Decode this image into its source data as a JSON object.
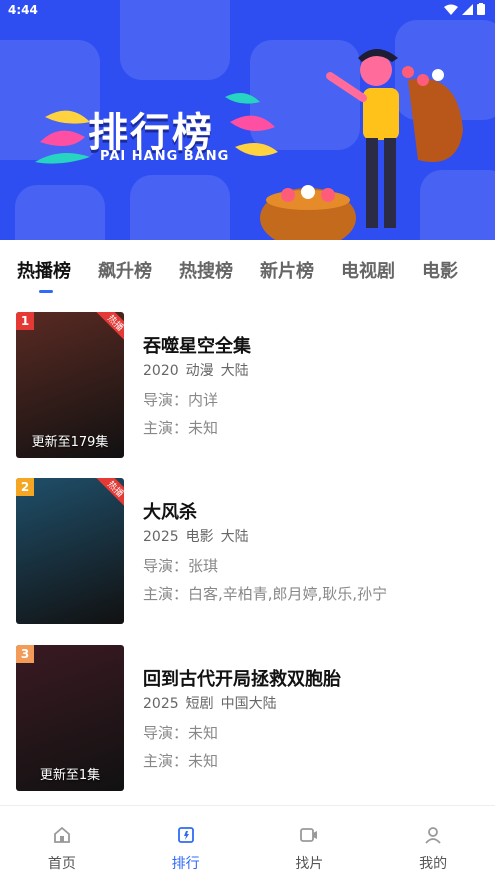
{
  "status": {
    "time": "4:44"
  },
  "banner": {
    "title": "排行榜",
    "subtitle": "PAI HANG BANG"
  },
  "tabs": [
    {
      "label": "热播榜",
      "active": true
    },
    {
      "label": "飙升榜",
      "active": false
    },
    {
      "label": "热搜榜",
      "active": false
    },
    {
      "label": "新片榜",
      "active": false
    },
    {
      "label": "电视剧",
      "active": false
    },
    {
      "label": "电影",
      "active": false
    }
  ],
  "items": [
    {
      "rank": "1",
      "title": "吞噬星空全集",
      "year": "2020",
      "type": "动漫",
      "region": "大陆",
      "director": "导演：内详",
      "cast": "主演：未知",
      "poster_caption": "更新至179集",
      "badge": "热播",
      "colors": {
        "rank": "#e53935",
        "poster": "#5a2a23"
      }
    },
    {
      "rank": "2",
      "title": "大风杀",
      "year": "2025",
      "type": "电影",
      "region": "大陆",
      "director": "导演：张琪",
      "cast": "主演：白客,辛柏青,郎月婷,耿乐,孙宁",
      "poster_caption": "",
      "badge": "热播",
      "colors": {
        "rank": "#f5a623",
        "poster": "#1f4f6a"
      }
    },
    {
      "rank": "3",
      "title": "回到古代开局拯救双胞胎",
      "year": "2025",
      "type": "短剧",
      "region": "中国大陆",
      "director": "导演：未知",
      "cast": "主演：未知",
      "poster_caption": "更新至1集",
      "badge": "",
      "colors": {
        "rank": "#f39c5a",
        "poster": "#3a1a22"
      }
    }
  ],
  "nav": [
    {
      "label": "首页",
      "icon": "home-icon",
      "active": false
    },
    {
      "label": "排行",
      "icon": "ranking-icon",
      "active": true
    },
    {
      "label": "找片",
      "icon": "video-icon",
      "active": false
    },
    {
      "label": "我的",
      "icon": "user-icon",
      "active": false
    }
  ],
  "colors": {
    "accent": "#2f6bf5",
    "banner": "#2f4ef2"
  }
}
